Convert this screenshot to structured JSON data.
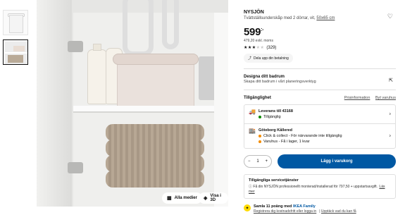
{
  "product": {
    "name": "NYSJÖN",
    "subtitle": "Tvättställsunderskåp med 2 dörrar, vit,",
    "size_link": "50x65 cm",
    "price_main": "599",
    "price_suffix": ":-",
    "price_ex_vat": "479,20 exkl. moms",
    "rating_value": 3.5,
    "rating_max": 5,
    "review_count": "(329)",
    "share_label": "Dela upp din betalning"
  },
  "image_controls": {
    "all_media": "Alla medier",
    "view_3d": "Visa i 3D"
  },
  "design": {
    "title": "Designa ditt badrum",
    "subtitle": "Skapa ditt badrum i vårt planeringsverktyg"
  },
  "availability": {
    "title": "Tillgänglighet",
    "link1": "Prisinformation",
    "link2": "Byt varuhus",
    "delivery_title": "Leverans till 43168",
    "delivery_status": "Tillgänglig",
    "store_title": "Göteborg Kållered",
    "store_line1": "Click & collect - För närvarande inte tillgänglig",
    "store_line2": "Varuhus - Få i lager, 1 kvar"
  },
  "cart": {
    "qty_minus": "−",
    "qty_value": "1",
    "qty_plus": "+",
    "button_label": "Lägg i varukorg"
  },
  "services": {
    "title": "Tillgängliga servicetjänster",
    "text": "Få din NYSJÖN professionellt monterad/installerad för 797,50 + uppstartsavgift.",
    "link": "Läs mer"
  },
  "family": {
    "text": "Samla 11 poäng med",
    "brand": "IKEA Family",
    "link1": "Registrera dig kostnadsfritt eller logga in",
    "link2": "Upptäck vad du kan få"
  },
  "colors": {
    "accent_blue": "#0058a3",
    "status_green": "#0a8a00",
    "status_orange": "#f28c00",
    "family_yellow": "#ffdb00"
  },
  "icons": [
    "heart-icon",
    "share-icon",
    "external-link-icon",
    "truck-icon",
    "store-icon",
    "chevron-right-icon",
    "info-icon",
    "family-icon",
    "grid-icon",
    "cube-3d-icon"
  ]
}
